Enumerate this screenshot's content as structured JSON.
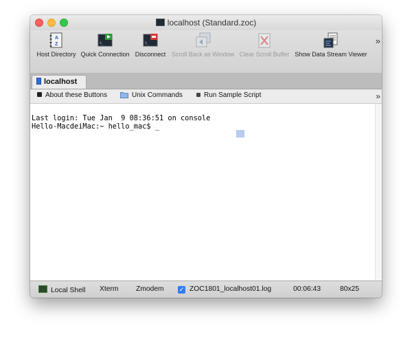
{
  "window": {
    "title": "localhost (Standard.zoc)"
  },
  "toolbar": {
    "buttons": [
      {
        "label": "Host Directory",
        "icon": "address-book-icon",
        "enabled": true
      },
      {
        "label": "Quick Connection",
        "icon": "quick-connect-icon",
        "enabled": true
      },
      {
        "label": "Disconnect",
        "icon": "disconnect-icon",
        "enabled": true
      },
      {
        "label": "Scroll Back as Window",
        "icon": "scrollback-icon",
        "enabled": false
      },
      {
        "label": "Clear Scroll Buffer",
        "icon": "clear-buffer-icon",
        "enabled": false
      },
      {
        "label": "Show Data Stream Viewer",
        "icon": "data-stream-icon",
        "enabled": true
      }
    ],
    "overflow": "»"
  },
  "tabs": [
    {
      "label": "localhost",
      "active": true
    }
  ],
  "userbar": {
    "items": [
      {
        "label": "About these Buttons",
        "icon": "info-button-icon"
      },
      {
        "label": "Unix Commands",
        "icon": "folder-icon"
      },
      {
        "label": "Run Sample Script",
        "icon": "script-button-icon"
      }
    ],
    "overflow": "»"
  },
  "terminal": {
    "lines": [
      "Last login: Tue Jan  9 08:36:51 on console",
      "Hello-MacdeiMac:~ hello_mac$ _"
    ]
  },
  "statusbar": {
    "session": "Local Shell",
    "emulation": "Xterm",
    "transfer": "Zmodem",
    "logfile": "ZOC1801_localhost01.log",
    "logging_enabled": true,
    "timer": "00:06:43",
    "size": "80x25"
  },
  "colors": {
    "titlebar": "#e2e2e2",
    "toolbar": "#d8d8d8",
    "accent": "#2f7df5",
    "terminal_bg": "#ffffff",
    "terminal_fg": "#000000"
  }
}
